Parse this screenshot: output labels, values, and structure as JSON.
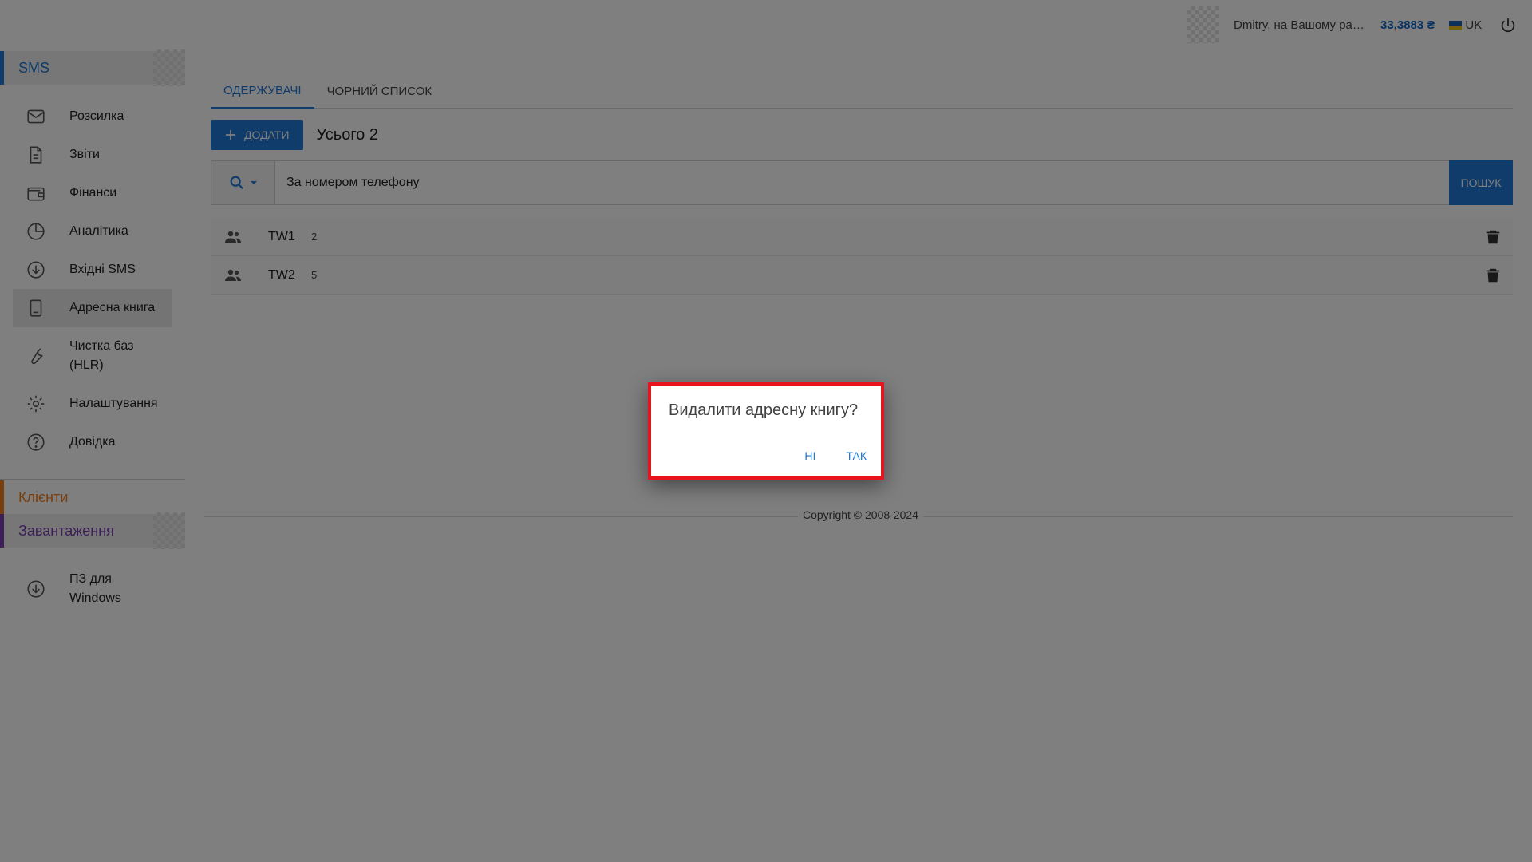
{
  "header": {
    "greeting": "Dmitry, на Вашому рахунку:",
    "balance": "33,3883 ₴",
    "language": "UK"
  },
  "sidebar": {
    "section_sms": "SMS",
    "items": [
      {
        "label": "Розсилка",
        "icon": "envelope-icon"
      },
      {
        "label": "Звіти",
        "icon": "document-icon"
      },
      {
        "label": "Фінанси",
        "icon": "wallet-icon"
      },
      {
        "label": "Аналітика",
        "icon": "pie-chart-icon"
      },
      {
        "label": "Вхідні SMS",
        "icon": "download-circle-icon"
      },
      {
        "label": "Адресна книга",
        "icon": "book-icon"
      },
      {
        "label": "Чистка баз (HLR)",
        "icon": "wrench-icon"
      },
      {
        "label": "Налаштування",
        "icon": "gear-icon"
      },
      {
        "label": "Довідка",
        "icon": "help-circle-icon"
      }
    ],
    "active_item": "Адресна книга",
    "section_clients": "Клієнти",
    "section_downloads": "Завантаження",
    "software_item": "ПЗ для Windows"
  },
  "main": {
    "tabs": [
      {
        "label": "Одержувачі",
        "active": true
      },
      {
        "label": "Чорний список",
        "active": false
      }
    ],
    "add_button": "Додати",
    "total": "Усього 2",
    "search": {
      "value": "За номером телефону",
      "button": "Пошук"
    },
    "groups": [
      {
        "name": "TW1",
        "count": "2"
      },
      {
        "name": "TW2",
        "count": "5"
      }
    ],
    "copyright": "Copyright © 2008-2024"
  },
  "dialog": {
    "title": "Видалити адресну книгу?",
    "no": "Ні",
    "yes": "Так"
  },
  "colors": {
    "accent": "#1e78d6",
    "clients": "#ef7d1f",
    "downloads": "#7b3fb0",
    "dialog_border": "#e8141c"
  }
}
